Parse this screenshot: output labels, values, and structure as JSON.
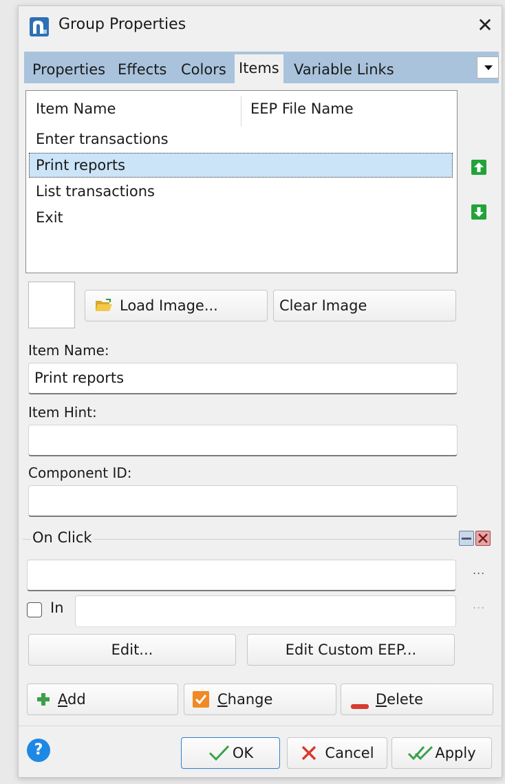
{
  "window": {
    "title": "Group Properties",
    "close_symbol": "✕"
  },
  "tabs": [
    {
      "label": "Properties",
      "active": false
    },
    {
      "label": "Effects",
      "active": false
    },
    {
      "label": "Colors",
      "active": false
    },
    {
      "label": "Items",
      "active": true
    },
    {
      "label": "Variable Links",
      "active": false
    }
  ],
  "item_list": {
    "columns": [
      "Item Name",
      "EEP File Name"
    ],
    "rows": [
      "Enter transactions",
      "Print reports",
      "List transactions",
      "Exit"
    ],
    "selected_index": 1
  },
  "image": {
    "load_label": "Load Image...",
    "clear_label": "Clear Image"
  },
  "fields": {
    "item_name_label": "Item Name:",
    "item_name_value": "Print reports",
    "item_hint_label": "Item Hint:",
    "item_hint_value": "",
    "component_id_label": "Component ID:",
    "component_id_value": ""
  },
  "on_click": {
    "label": "On Click",
    "value": "",
    "dots": "...",
    "in_label": "In",
    "in_checked": false,
    "in_value": "",
    "edit_label": "Edit...",
    "edit_custom_label": "Edit Custom EEP..."
  },
  "actions": {
    "add_prefix": "",
    "add_underline": "A",
    "add_rest": "dd",
    "change_underline": "C",
    "change_rest": "hange",
    "delete_underline": "D",
    "delete_rest": "elete"
  },
  "footer": {
    "help_symbol": "?",
    "ok_label": "OK",
    "cancel_label": "Cancel",
    "apply_label": "Apply"
  },
  "colors": {
    "tab_bar": "#a9c3dc",
    "selection": "#cce4f7",
    "accent_blue": "#1e88e5",
    "arrow_green": "#22a33a"
  }
}
